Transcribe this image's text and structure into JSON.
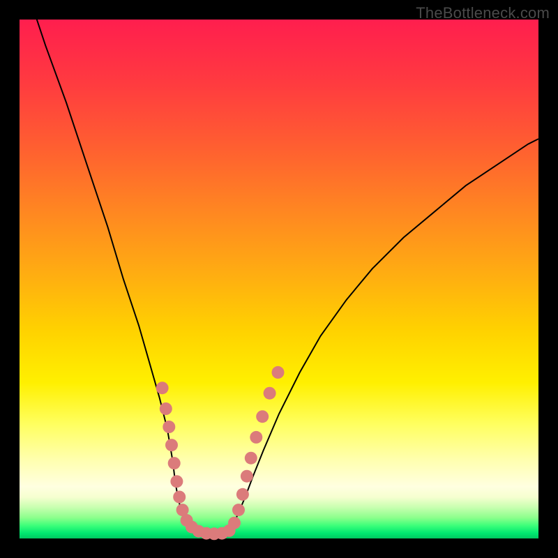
{
  "watermark": "TheBottleneck.com",
  "chart_data": {
    "type": "line",
    "title": "",
    "xlabel": "",
    "ylabel": "",
    "xlim": [
      0,
      100
    ],
    "ylim": [
      0,
      100
    ],
    "series": [
      {
        "name": "left-branch",
        "x": [
          2,
          5,
          9,
          13,
          17,
          20,
          23,
          25,
          27,
          28.5,
          29.5,
          30,
          30.5,
          31,
          32,
          33,
          34
        ],
        "values": [
          104,
          95,
          84,
          72,
          60,
          50,
          41,
          34,
          27,
          21,
          15,
          11,
          8,
          6,
          3.5,
          2,
          1.3
        ]
      },
      {
        "name": "valley-floor",
        "x": [
          34,
          35,
          36,
          37,
          38,
          39,
          40
        ],
        "values": [
          1.3,
          1.0,
          0.9,
          0.9,
          0.9,
          1.0,
          1.3
        ]
      },
      {
        "name": "right-branch",
        "x": [
          40,
          41,
          42,
          43.5,
          45,
          47,
          50,
          54,
          58,
          63,
          68,
          74,
          80,
          86,
          92,
          98,
          100
        ],
        "values": [
          1.3,
          2.3,
          4.5,
          8,
          12,
          17,
          24,
          32,
          39,
          46,
          52,
          58,
          63,
          68,
          72,
          76,
          77
        ]
      }
    ],
    "markers": {
      "name": "highlight-dots",
      "color": "#db7b7b",
      "radius_px": 9,
      "points": [
        {
          "x": 27.5,
          "y": 29
        },
        {
          "x": 28.2,
          "y": 25
        },
        {
          "x": 28.8,
          "y": 21.5
        },
        {
          "x": 29.3,
          "y": 18
        },
        {
          "x": 29.8,
          "y": 14.5
        },
        {
          "x": 30.3,
          "y": 11
        },
        {
          "x": 30.8,
          "y": 8
        },
        {
          "x": 31.4,
          "y": 5.5
        },
        {
          "x": 32.2,
          "y": 3.5
        },
        {
          "x": 33.2,
          "y": 2.2
        },
        {
          "x": 34.5,
          "y": 1.4
        },
        {
          "x": 36.0,
          "y": 1.0
        },
        {
          "x": 37.5,
          "y": 0.9
        },
        {
          "x": 39.0,
          "y": 1.0
        },
        {
          "x": 40.4,
          "y": 1.5
        },
        {
          "x": 41.4,
          "y": 3.0
        },
        {
          "x": 42.2,
          "y": 5.5
        },
        {
          "x": 43.0,
          "y": 8.5
        },
        {
          "x": 43.8,
          "y": 12
        },
        {
          "x": 44.6,
          "y": 15.5
        },
        {
          "x": 45.6,
          "y": 19.5
        },
        {
          "x": 46.8,
          "y": 23.5
        },
        {
          "x": 48.2,
          "y": 28
        },
        {
          "x": 49.8,
          "y": 32
        }
      ]
    },
    "gradient_stops": [
      {
        "offset": 0,
        "color": "#ff1e4e"
      },
      {
        "offset": 0.25,
        "color": "#ff6030"
      },
      {
        "offset": 0.5,
        "color": "#ffb010"
      },
      {
        "offset": 0.7,
        "color": "#fff000"
      },
      {
        "offset": 0.9,
        "color": "#ffffe0"
      },
      {
        "offset": 1.0,
        "color": "#00c860"
      }
    ]
  }
}
